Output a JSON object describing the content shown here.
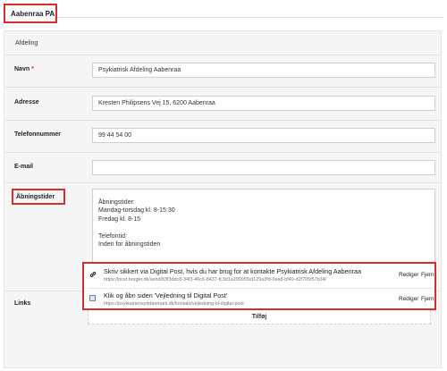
{
  "header": {
    "tab_label": "Aabenraa PA"
  },
  "section": {
    "title": "Afdeling"
  },
  "fields": {
    "name": {
      "label": "Navn",
      "required": "*",
      "value": "Psykiatrisk Afdeling Aabenraa"
    },
    "address": {
      "label": "Adresse",
      "value": "Kresten Philipsens Vej 15, 6200 Aabenraa"
    },
    "phone": {
      "label": "Telefonnummer",
      "value": "99 44 54 00"
    },
    "email": {
      "label": "E-mail",
      "value": ""
    },
    "opening_hours": {
      "label": "Åbningstider",
      "lines": [
        "Åbningstider:",
        "Mandag-torsdag kl. 8-15:30",
        "Fredag kl. 8-15",
        "",
        "Telefontid:",
        "Inden for åbningstiden"
      ]
    }
  },
  "links": {
    "label": "Links",
    "items": [
      {
        "icon": "link-icon",
        "title": "Skriv sikkert via Digital Post, hvis du har brug for at kontakte Psykiatrisk Afdeling Aabenraa",
        "url": "https://post.borger.dk/send/83f3ddc8-34f3-46c6-8437-fc3d1a299955/d129a3fd-0ea8-bf49-d2f705f57b34/",
        "edit_label": "Rediger",
        "remove_label": "Fjern"
      },
      {
        "icon": "favicon-icon",
        "title": "Klik og åbn siden 'Vejledning til Digital Post'",
        "url": "https://psykiatriensyddanmark.dk/kontakt/vejledning-til-digital-post",
        "edit_label": "Rediger",
        "remove_label": "Fjern"
      }
    ],
    "add_label": "Tilføj"
  },
  "colors": {
    "highlight": "#d62d2d",
    "panel": "#f5f5f5"
  }
}
